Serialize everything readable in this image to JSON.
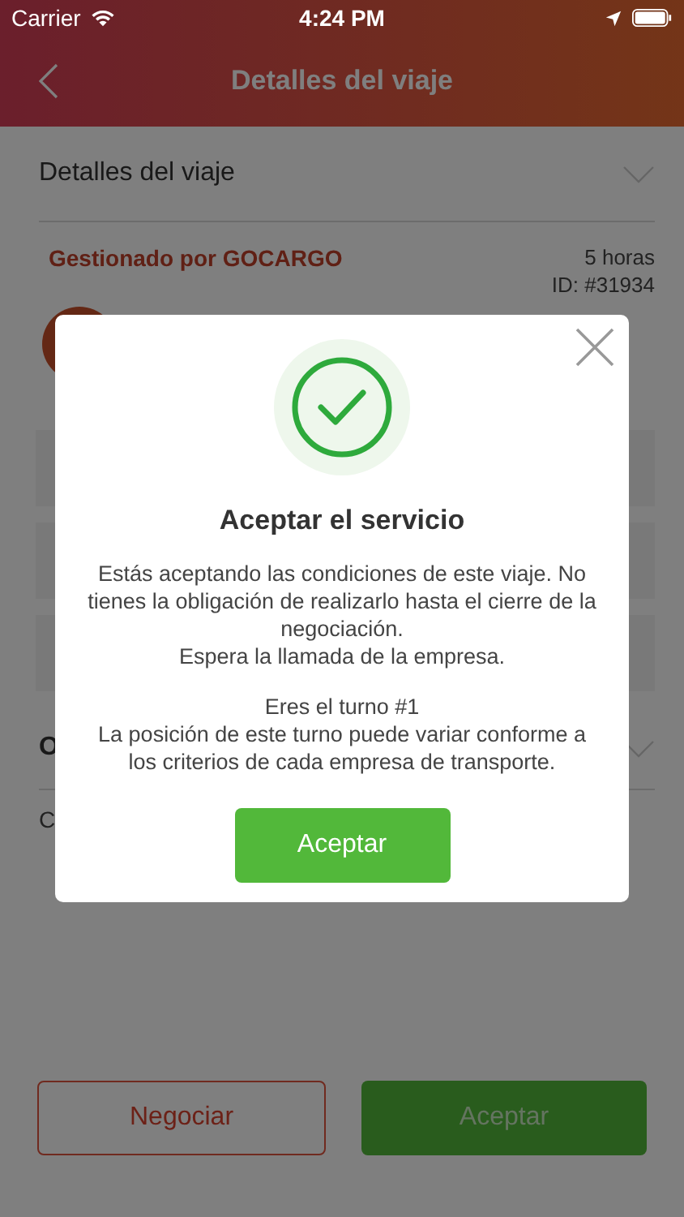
{
  "status_bar": {
    "carrier": "Carrier",
    "time": "4:24 PM"
  },
  "header": {
    "title": "Detalles del viaje"
  },
  "section": {
    "title": "Detalles del viaje"
  },
  "trip": {
    "managed_by": "Gestionado por GOCARGO",
    "age": "5 horas",
    "id": "ID: #31934"
  },
  "section_2": {
    "title": "O",
    "text": "C"
  },
  "actions": [
    {
      "label": "Negociar",
      "kind": "outline"
    },
    {
      "label": "Aceptar",
      "kind": "filled"
    }
  ],
  "dialog": {
    "title": "Aceptar el servicio",
    "paragraphs": [
      [
        "Estás aceptando las condiciones de este viaje. No tienes la obligación de realizarlo hasta el cierre de la negociación.",
        "Espera la llamada de la empresa."
      ],
      [
        "Eres el turno #1",
        "La posición de este turno puede variar conforme a los criterios de cada empresa de transporte."
      ]
    ],
    "button": "Aceptar"
  }
}
